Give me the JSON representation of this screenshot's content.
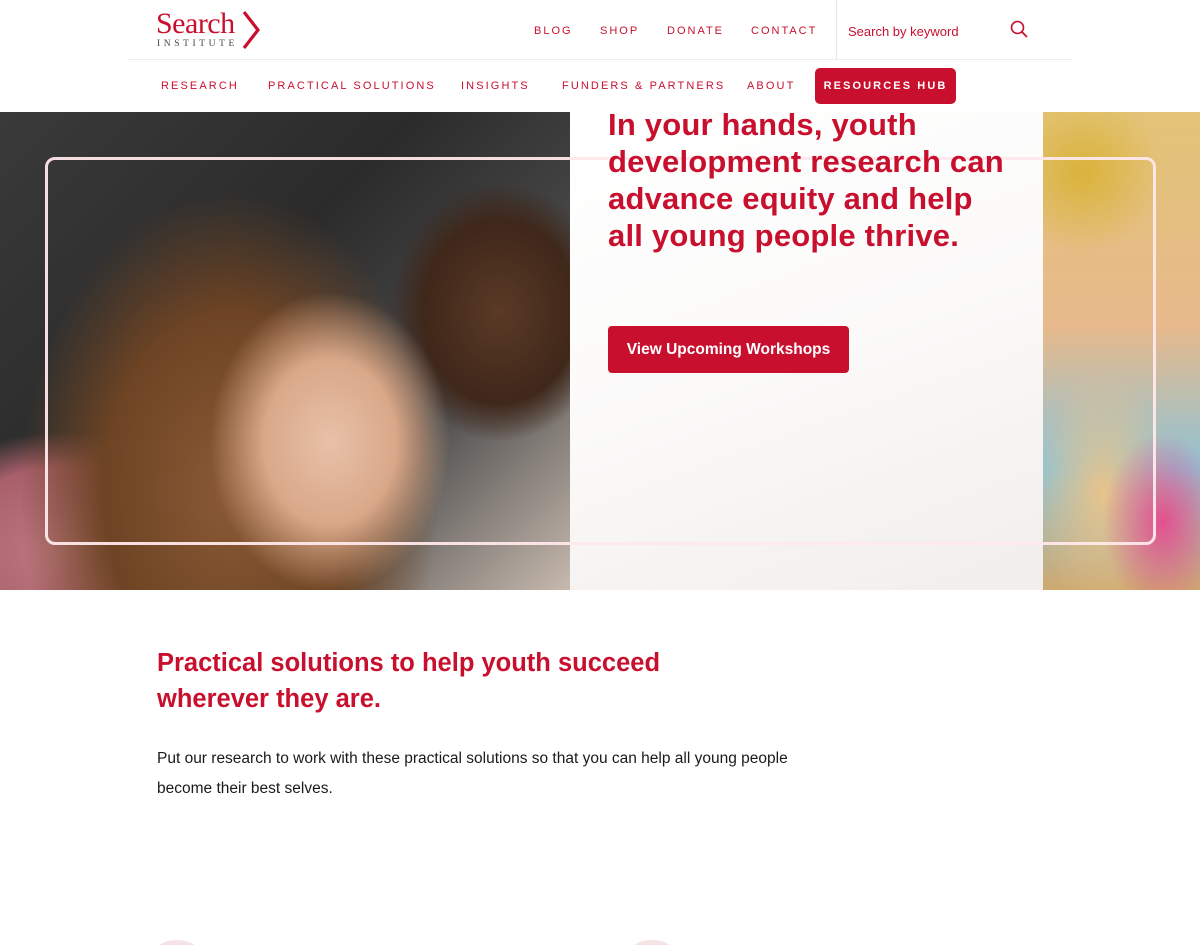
{
  "logo": {
    "word": "Search",
    "sub": "INSTITUTE"
  },
  "top_nav": {
    "blog": "BLOG",
    "shop": "SHOP",
    "donate": "DONATE",
    "contact": "CONTACT"
  },
  "search": {
    "placeholder": "Search by keyword"
  },
  "main_nav": {
    "items": [
      "RESEARCH",
      "PRACTICAL SOLUTIONS",
      "INSIGHTS",
      "FUNDERS & PARTNERS",
      "ABOUT"
    ],
    "hub": "RESOURCES HUB"
  },
  "hero": {
    "heading": "In your hands, youth development research can advance equity and help all young people thrive.",
    "cta": "View Upcoming Workshops"
  },
  "section": {
    "title": "Practical solutions to help youth succeed wherever they are.",
    "body": "Put our research to work with these practical solutions so that you can help all young people become their best selves."
  },
  "colors": {
    "brand": "#c8102e",
    "text": "#1a1a1a"
  },
  "icons": {
    "search": "search-icon",
    "logo_chevron": "chevron-right-icon"
  }
}
